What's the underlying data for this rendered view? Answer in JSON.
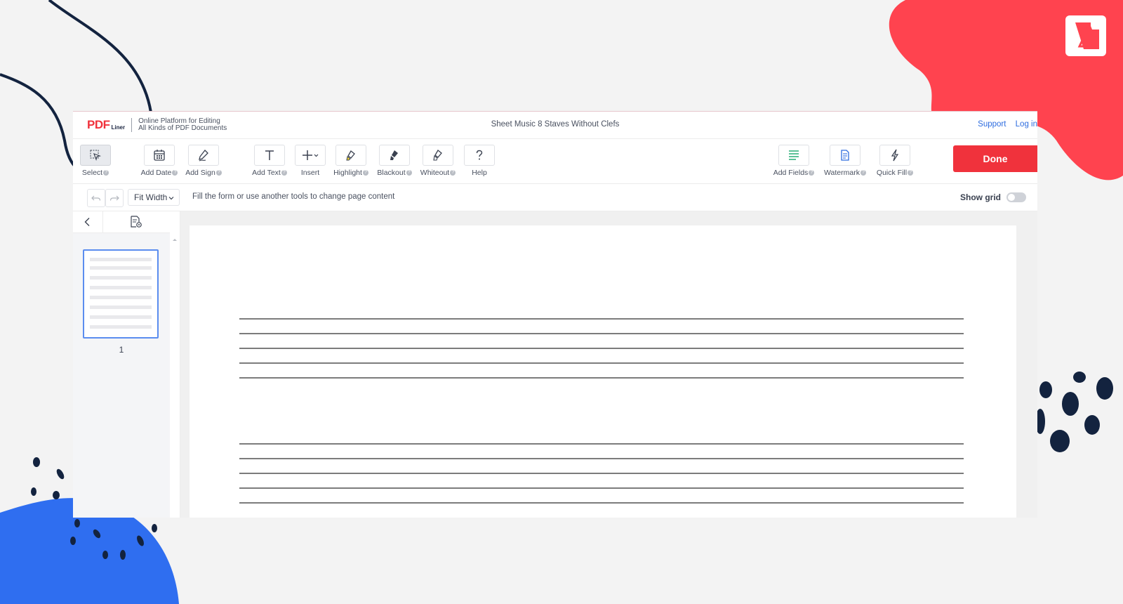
{
  "colors": {
    "brand_red": "#f0323c",
    "link_blue": "#2d6cdf",
    "deco_navy": "#13233f",
    "deco_blue": "#2f6ef0",
    "deco_red": "#ff434f"
  },
  "header": {
    "brand_logo": "PDF",
    "brand_liner": "Liner",
    "tagline_line1": "Online Platform for Editing",
    "tagline_line2": "All Kinds of PDF Documents",
    "document_title": "Sheet Music 8 Staves Without Clefs",
    "support_link": "Support",
    "login_link": "Log in"
  },
  "toolbar": {
    "tools": [
      {
        "label": "Select",
        "icon": "cursor-icon"
      },
      {
        "label": "Add Date",
        "icon": "calendar-icon"
      },
      {
        "label": "Add Sign",
        "icon": "pen-icon"
      },
      {
        "label": "Add Text",
        "icon": "text-icon"
      },
      {
        "label": "Insert",
        "icon": "plus-icon"
      },
      {
        "label": "Highlight",
        "icon": "highlighter-icon"
      },
      {
        "label": "Blackout",
        "icon": "blackout-icon"
      },
      {
        "label": "Whiteout",
        "icon": "eraser-icon"
      },
      {
        "label": "Help",
        "icon": "question-icon"
      },
      {
        "label": "Add Fields",
        "icon": "fields-icon"
      },
      {
        "label": "Watermark",
        "icon": "watermark-icon"
      },
      {
        "label": "Quick Fill",
        "icon": "lightning-icon"
      }
    ],
    "help_mark": "?",
    "done_label": "Done"
  },
  "subbar": {
    "zoom_value": "Fit Width",
    "hint": "Fill the form or use another tools to change page content",
    "show_grid_label": "Show grid"
  },
  "sidebar": {
    "page_number": "1"
  }
}
